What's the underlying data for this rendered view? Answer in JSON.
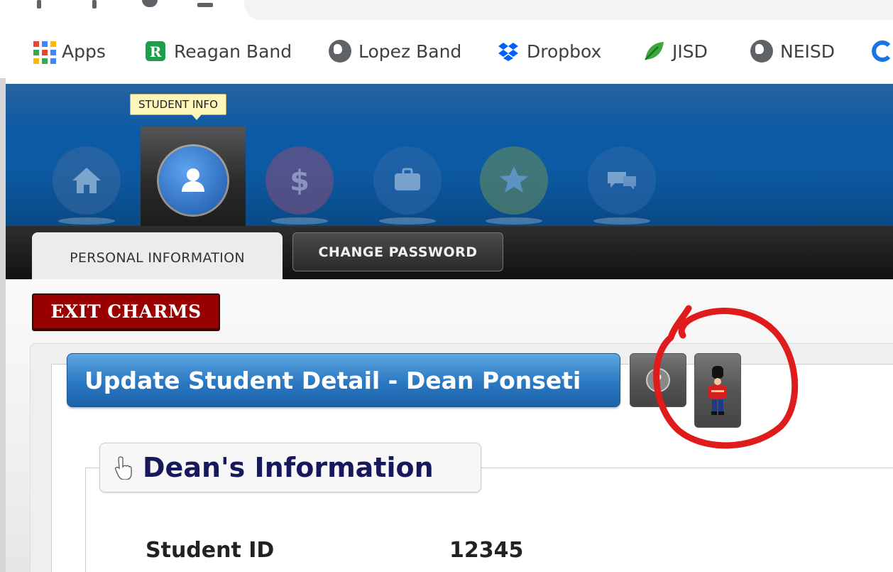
{
  "browser": {
    "bookmarks": [
      {
        "label": "Apps",
        "icon": "apps-grid-icon"
      },
      {
        "label": "Reagan Band",
        "icon": "reagan-logo-icon"
      },
      {
        "label": "Lopez Band",
        "icon": "globe-icon"
      },
      {
        "label": "Dropbox",
        "icon": "dropbox-icon"
      },
      {
        "label": "JISD",
        "icon": "leaf-icon"
      },
      {
        "label": "NEISD",
        "icon": "globe-icon"
      }
    ]
  },
  "app": {
    "tooltip": "STUDENT INFO",
    "nav": [
      {
        "name": "home",
        "icon": "home-icon",
        "color": "#3a6aa0"
      },
      {
        "name": "student-info",
        "icon": "user-icon",
        "color": "#2a6dc4",
        "active": true
      },
      {
        "name": "finance",
        "icon": "dollar-icon",
        "color": "#8a4f7a"
      },
      {
        "name": "briefcase",
        "icon": "briefcase-icon",
        "color": "#2d67a8"
      },
      {
        "name": "star",
        "icon": "star-icon",
        "color": "#6b8f5a"
      },
      {
        "name": "messages",
        "icon": "chat-icon",
        "color": "#2d67a8"
      }
    ],
    "tabs": {
      "active": "PERSONAL INFORMATION",
      "other": "CHANGE PASSWORD"
    },
    "exit_button": "EXIT CHARMS",
    "panel": {
      "title": "Update Student Detail - Dean Ponseti",
      "help_icon": "question-icon",
      "uniform_icon": "toy-soldier-icon",
      "section_title": "Dean's Information",
      "fields": [
        {
          "label": "Student ID",
          "value": "12345"
        }
      ]
    }
  },
  "colors": {
    "header_blue": "#0b5aa6",
    "exit_red": "#990000",
    "title_blue": "#2a78c2",
    "annotation_red": "#e01b1b",
    "section_navy": "#18185c"
  }
}
